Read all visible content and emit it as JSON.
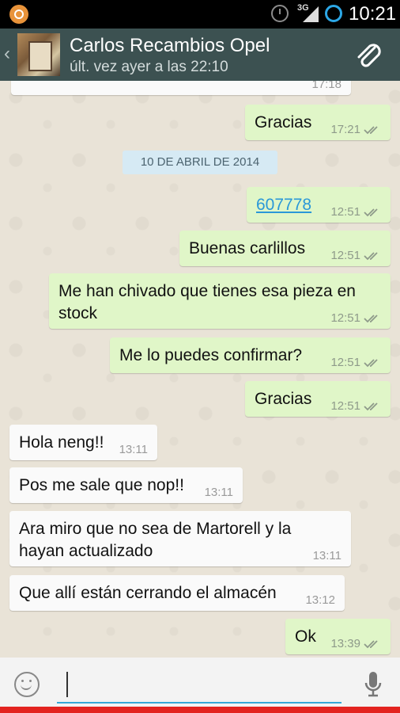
{
  "status_bar": {
    "network": "3G",
    "time": "10:21"
  },
  "header": {
    "contact_name": "Carlos Recambios Opel",
    "last_seen": "últ. vez ayer a las 22:10"
  },
  "date_separator": "10 DE ABRIL DE 2014",
  "messages": [
    {
      "id": "m0",
      "direction": "in",
      "text": "",
      "time": "17:18"
    },
    {
      "id": "m1",
      "direction": "out",
      "text": "Gracias",
      "time": "17:21",
      "status": "read-double-check"
    },
    {
      "id": "m2",
      "direction": "out",
      "text": "607778",
      "time": "12:51",
      "status": "read-double-check",
      "is_link": true
    },
    {
      "id": "m3",
      "direction": "out",
      "text": "Buenas carlillos",
      "time": "12:51",
      "status": "read-double-check"
    },
    {
      "id": "m4",
      "direction": "out",
      "text": "Me han chivado que tienes esa pieza en stock",
      "time": "12:51",
      "status": "read-double-check"
    },
    {
      "id": "m5",
      "direction": "out",
      "text": "Me lo puedes confirmar?",
      "time": "12:51",
      "status": "read-double-check"
    },
    {
      "id": "m6",
      "direction": "out",
      "text": "Gracias",
      "time": "12:51",
      "status": "read-double-check"
    },
    {
      "id": "m7",
      "direction": "in",
      "text": "Hola neng!!",
      "time": "13:11"
    },
    {
      "id": "m8",
      "direction": "in",
      "text": "Pos me sale que nop!!",
      "time": "13:11"
    },
    {
      "id": "m9",
      "direction": "in",
      "text": "Ara miro que no sea de Martorell y la hayan actualizado",
      "time": "13:11"
    },
    {
      "id": "m10",
      "direction": "in",
      "text": "Que allí están cerrando el almacén",
      "time": "13:12"
    },
    {
      "id": "m11",
      "direction": "out",
      "text": "Ok",
      "time": "13:39",
      "status": "read-double-check"
    }
  ],
  "input": {
    "value": "",
    "placeholder": ""
  },
  "icons": {
    "notification": "app-notification-icon",
    "alarm": "alarm-icon",
    "signal": "signal-icon",
    "sync": "sync-icon",
    "back": "back-chevron-icon",
    "attach": "paperclip-icon",
    "emoji": "smiley-icon",
    "mic": "microphone-icon",
    "ticks": "double-check-icon"
  },
  "colors": {
    "header_bg": "#3c5151",
    "outgoing_bubble": "#e0f6c8",
    "incoming_bubble": "#fafafa",
    "link": "#2a98d8",
    "accent": "#35a8d8"
  }
}
